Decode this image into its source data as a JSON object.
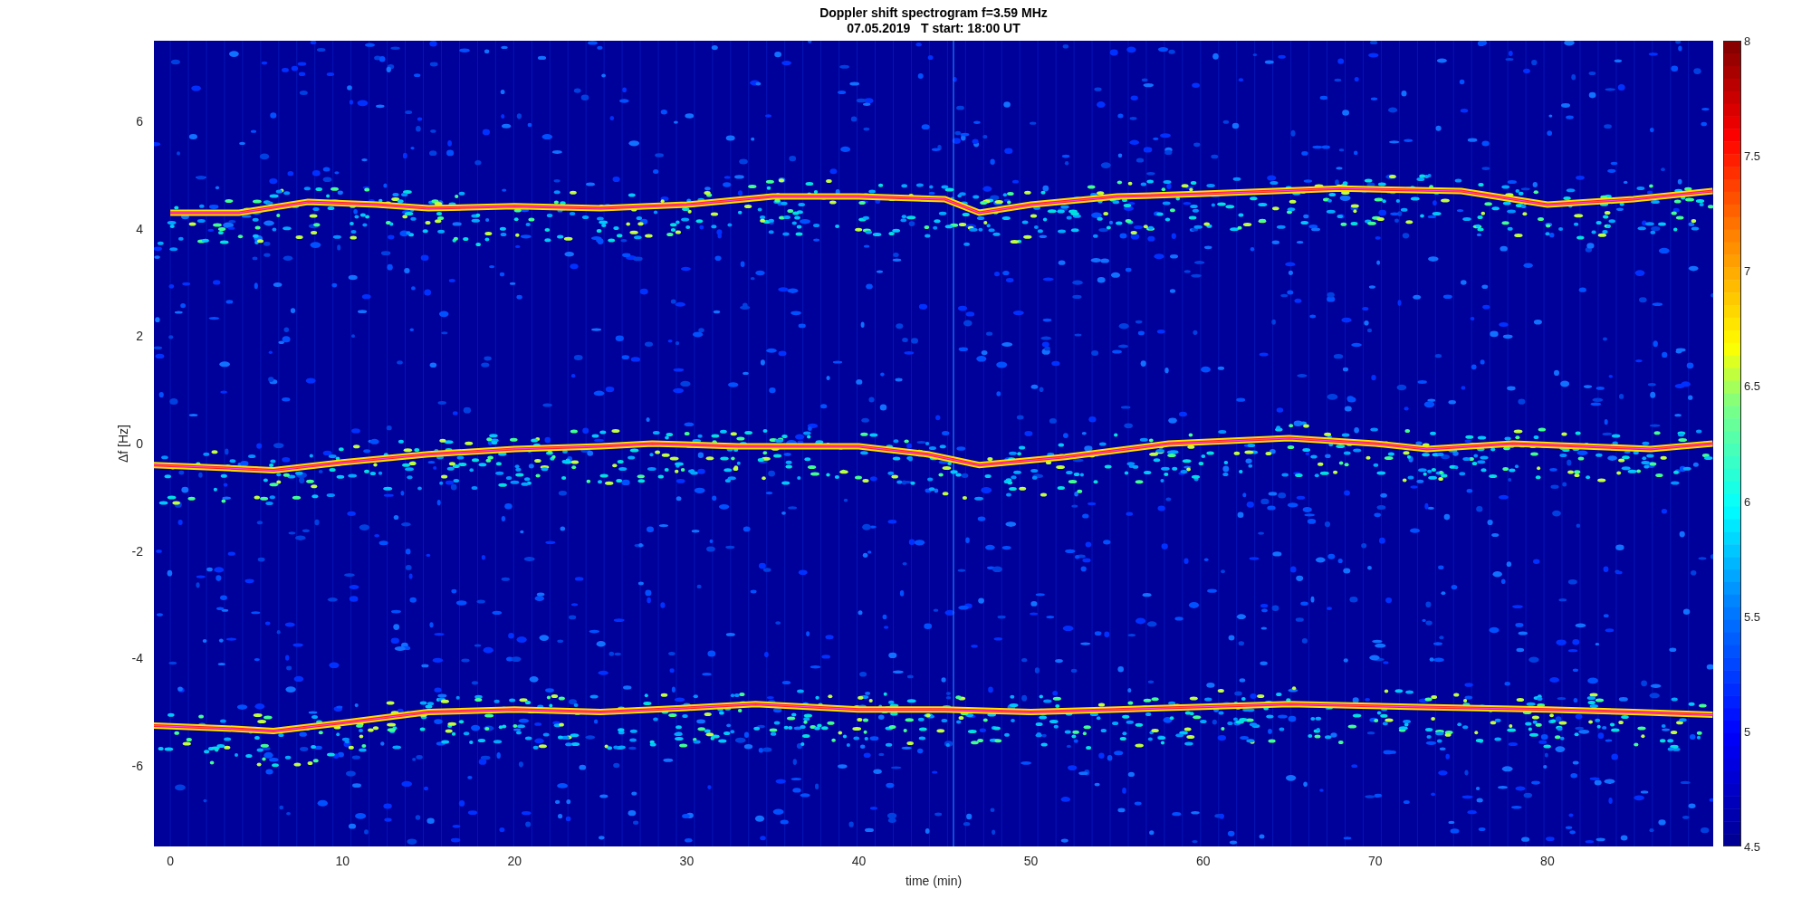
{
  "figure": {
    "title_lines": [
      "Doppler shift spectrogram f=3.59 MHz",
      "07.05.2019   T start: 18:00 UT"
    ],
    "ylabel": "Δf [Hz]",
    "xlabel": "time (min)",
    "yticks": [
      "6",
      "4",
      "2",
      "0",
      "-2",
      "-4",
      "-6"
    ],
    "xticks": [
      "0",
      "10",
      "20",
      "30",
      "40",
      "50",
      "60",
      "70",
      "80"
    ],
    "colorbar": {
      "ticks": [
        "8",
        "7.5",
        "7",
        "6.5",
        "6",
        "5.5",
        "5",
        "4.5"
      ]
    }
  }
}
